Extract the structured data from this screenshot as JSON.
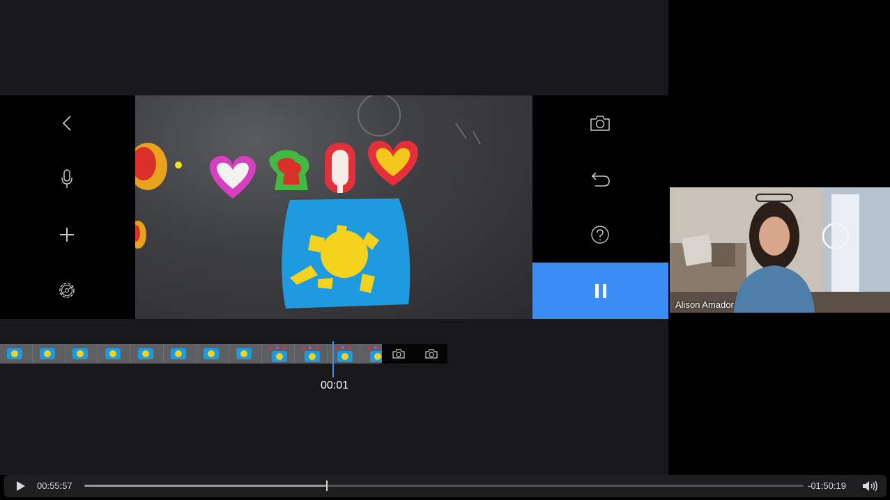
{
  "preview_panel": {
    "playing": true
  },
  "timeline": {
    "current_time": "00:01",
    "playhead_fraction": 0.87
  },
  "participant": {
    "name": "Alison Amador"
  },
  "player": {
    "elapsed": "00:55:57",
    "remaining": "-01:50:19",
    "progress_fraction": 0.336
  },
  "icons": {
    "left_tools": [
      "back-chevron-icon",
      "microphone-icon",
      "plus-icon",
      "settings-gear-icon"
    ],
    "right_tools": [
      "camera-icon",
      "undo-icon",
      "help-icon"
    ],
    "play_button": "pause-icon"
  },
  "colors": {
    "accent": "#3a8df5",
    "panel_bg": "#19191d"
  }
}
